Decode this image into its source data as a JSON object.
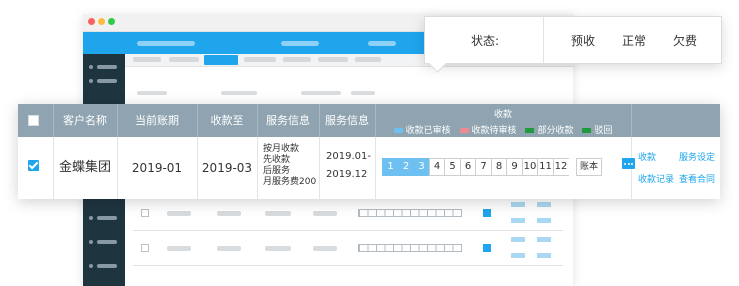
{
  "status_popup": {
    "label": "状态:",
    "options": [
      "预收",
      "正常",
      "欠费"
    ]
  },
  "table": {
    "headers": {
      "customer": "客户名称",
      "current_period": "当前账期",
      "collected_to": "收款至",
      "service_info_1": "服务信息",
      "service_info_2": "服务信息",
      "collection_title": "收款"
    },
    "legend": [
      {
        "label": "收款已审核",
        "color": "#6ec0f1"
      },
      {
        "label": "收款待审核",
        "color": "#f08a92"
      },
      {
        "label": "部分收款",
        "color": "#1f9a3f"
      },
      {
        "label": "驳回",
        "color": "#1f9a3f"
      }
    ],
    "row": {
      "checked": true,
      "customer": "金蝶集团",
      "current_period": "2019-01",
      "collected_to": "2019-03",
      "service_lines": [
        "按月收款",
        "先收款",
        "后服务",
        "月服务费200"
      ],
      "date_from": "2019.01-",
      "date_to": "2019.12",
      "months": [
        "1",
        "2",
        "3",
        "4",
        "5",
        "6",
        "7",
        "8",
        "9",
        "10",
        "11",
        "12"
      ],
      "months_paid": 3,
      "book_label": "账本",
      "actions": [
        "收款",
        "服务设定",
        "收款记录",
        "查看合同"
      ]
    }
  },
  "colors": {
    "accent": "#1ea5ec",
    "header_bg": "#8fa4b0",
    "sidebar_bg": "#1e3540"
  }
}
